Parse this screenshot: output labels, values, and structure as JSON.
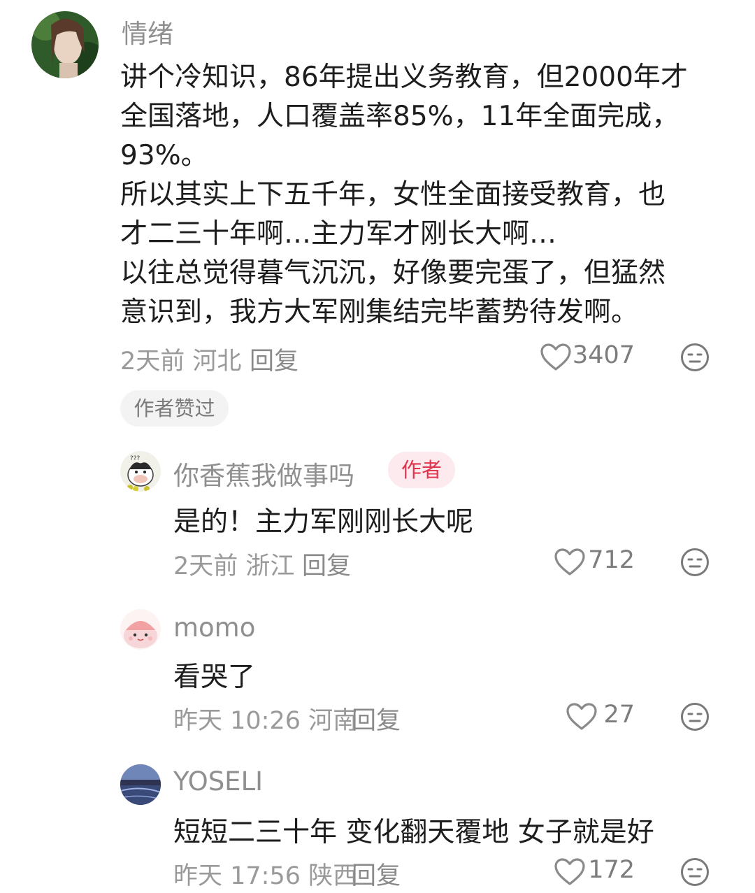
{
  "comments": [
    {
      "username": "情绪",
      "lines": [
        "讲个冷知识，86年提出义务教育，但2000年才",
        "全国落地，人口覆盖率85%，11年全面完成，",
        "93%。",
        "所以其实上下五千年，女性全面接受教育，也",
        "才二三十年啊…主力军才刚长大啊…",
        "以往总觉得暮气沉沉，好像要完蛋了，但猛然",
        "意识到，我方大军刚集结完毕蓄势待发啊。"
      ],
      "meta": "2天前 河北",
      "reply": "回复",
      "likes": "3407",
      "author_liked": "作者赞过"
    }
  ],
  "replies": [
    {
      "username": "你香蕉我做事吗",
      "tag": "作者",
      "text": "是的！主力军刚刚长大呢",
      "meta": "2天前 浙江",
      "reply": "回复",
      "likes": "712"
    },
    {
      "username": "momo",
      "text": "看哭了",
      "meta": "昨天 10:26 河南",
      "reply": "回复",
      "likes": "27"
    },
    {
      "username": "YOSELI",
      "text": "短短二三十年 变化翻天覆地 女子就是好",
      "meta": "昨天 17:56 陕西",
      "reply": "回复",
      "likes": "172"
    }
  ]
}
